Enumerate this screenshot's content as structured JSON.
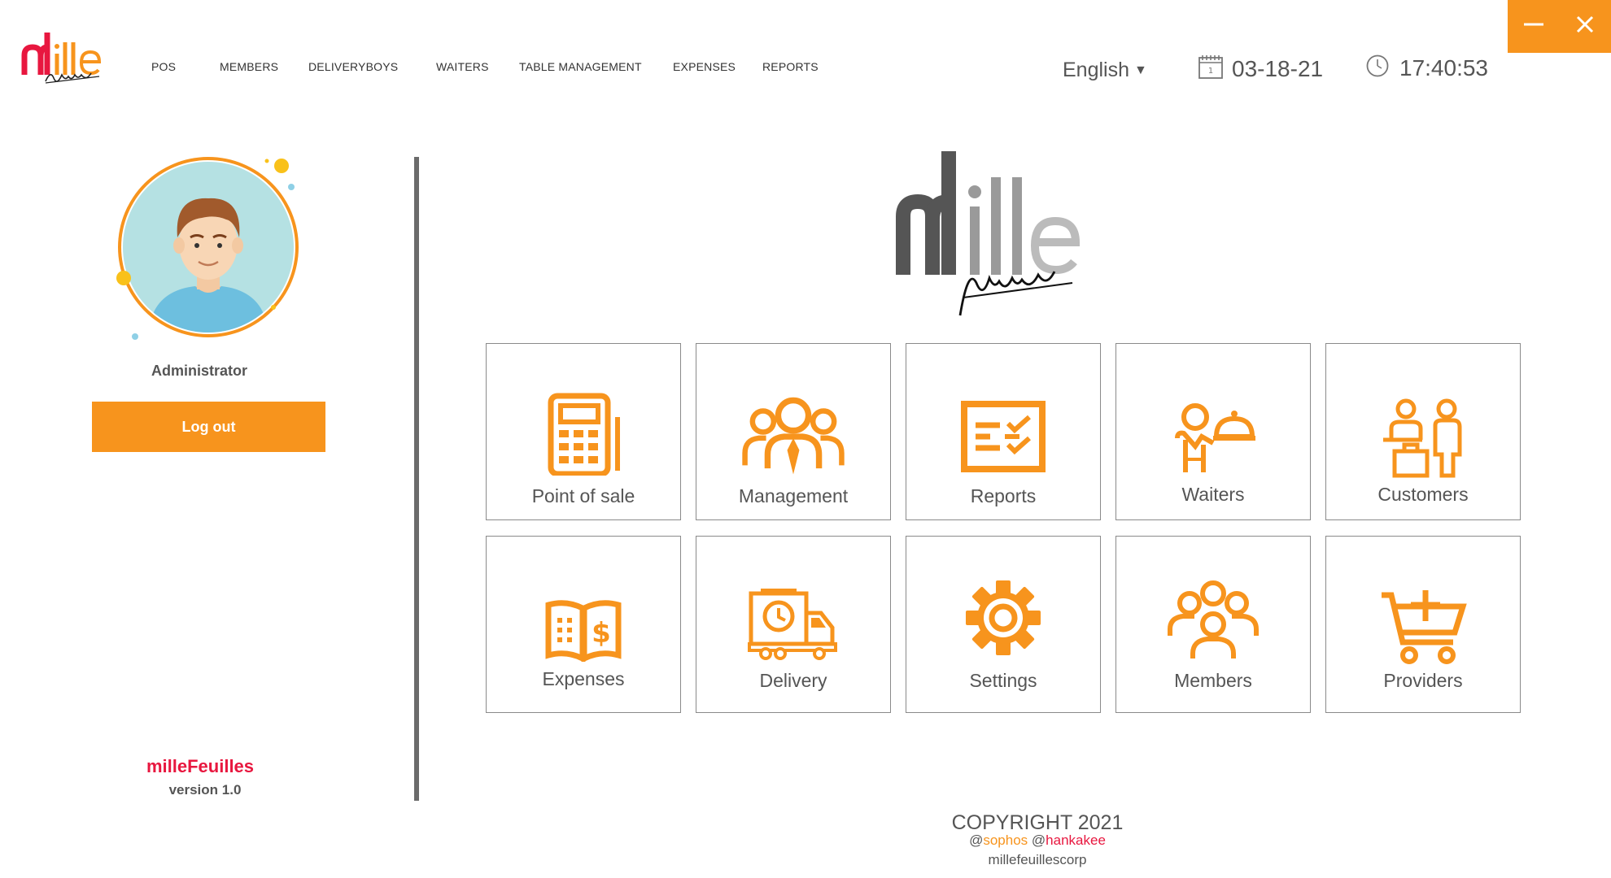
{
  "nav": {
    "items": [
      "POS",
      "MEMBERS",
      "DELIVERYBOYS",
      "WAITERS",
      "TABLE MANAGEMENT",
      "EXPENSES",
      "REPORTS"
    ]
  },
  "header": {
    "language": "English",
    "date": "03-18-21",
    "time": "17:40:53"
  },
  "sidebar": {
    "role": "Administrator",
    "logout_label": "Log out",
    "app_name": "milleFeuilles",
    "version": "version 1.0"
  },
  "tiles": [
    {
      "label": "Point of sale",
      "icon": "calculator-icon"
    },
    {
      "label": "Management",
      "icon": "team-icon"
    },
    {
      "label": "Reports",
      "icon": "checklist-icon"
    },
    {
      "label": "Waiters",
      "icon": "waiter-icon"
    },
    {
      "label": "Customers",
      "icon": "customers-luggage-icon"
    },
    {
      "label": "Expenses",
      "icon": "ledger-dollar-icon"
    },
    {
      "label": "Delivery",
      "icon": "delivery-truck-icon"
    },
    {
      "label": "Settings",
      "icon": "gear-icon"
    },
    {
      "label": "Members",
      "icon": "members-icon"
    },
    {
      "label": "Providers",
      "icon": "cart-plus-icon"
    }
  ],
  "footer": {
    "copyright": "COPYRIGHT 2021",
    "credit_1": "@sophos",
    "credit_1_at": "@",
    "credit_1_name": "sophos",
    "credit_2_at": "@",
    "credit_2_name": "hankakee",
    "corp": "millefeuillescorp"
  },
  "colors": {
    "accent": "#f7941d",
    "brand_red": "#e8173f",
    "text": "#555555"
  }
}
